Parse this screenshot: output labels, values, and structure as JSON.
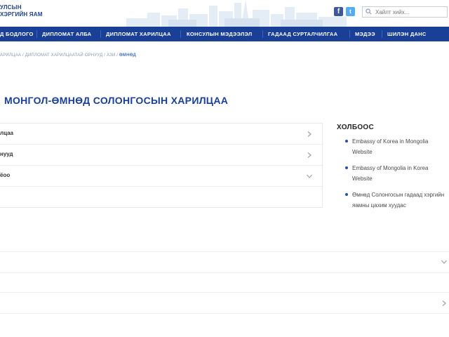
{
  "header": {
    "logo_line1": "УЛСЫН",
    "logo_line2": "ХЭРГИЙН ЯАМ",
    "social": {
      "facebook": "f",
      "twitter": "t"
    },
    "search": {
      "placeholder": "Хайлт хийх..."
    }
  },
  "nav": {
    "items": [
      "Д БОДЛОГО",
      "ДИПЛОМАТ АЛБА",
      "ДИПЛОМАТ ХАРИЛЦАА",
      "КОНСУЛЫН МЭДЭЭЛЭЛ",
      "ГАДААД СУРТАЛЧИЛГАА",
      "МЭДЭЭ",
      "ШИЛЭН ДАНС"
    ]
  },
  "breadcrumb": {
    "path": "АРИЛЦАА / ДИПЛОМАТ ХАРИЛЦААТАЙ ОРНУУД / АЗИ / ",
    "current": "ӨМНӨД"
  },
  "page_title": "МОНГОЛ-ӨМНӨД СОЛОНГОСЫН ХАРИЛЦАА",
  "accordion": {
    "items": [
      {
        "label": "лцаа",
        "state": "collapsed"
      },
      {
        "label": "нууд",
        "state": "collapsed"
      },
      {
        "label": "ёоо",
        "state": "expanded"
      }
    ]
  },
  "sidebar": {
    "title": "ХОЛБООС",
    "links": [
      "Embassy of Korea in Mongolia Website",
      "Embassy of Mongolia in Korea Website",
      "Өмнөд Солонгосын гадаад хэргийн яамны цахим хуудас"
    ]
  },
  "colors": {
    "nav_bg": "#1a3f96",
    "title": "#1a3f96",
    "breadcrumb_current": "#4a74c0"
  }
}
